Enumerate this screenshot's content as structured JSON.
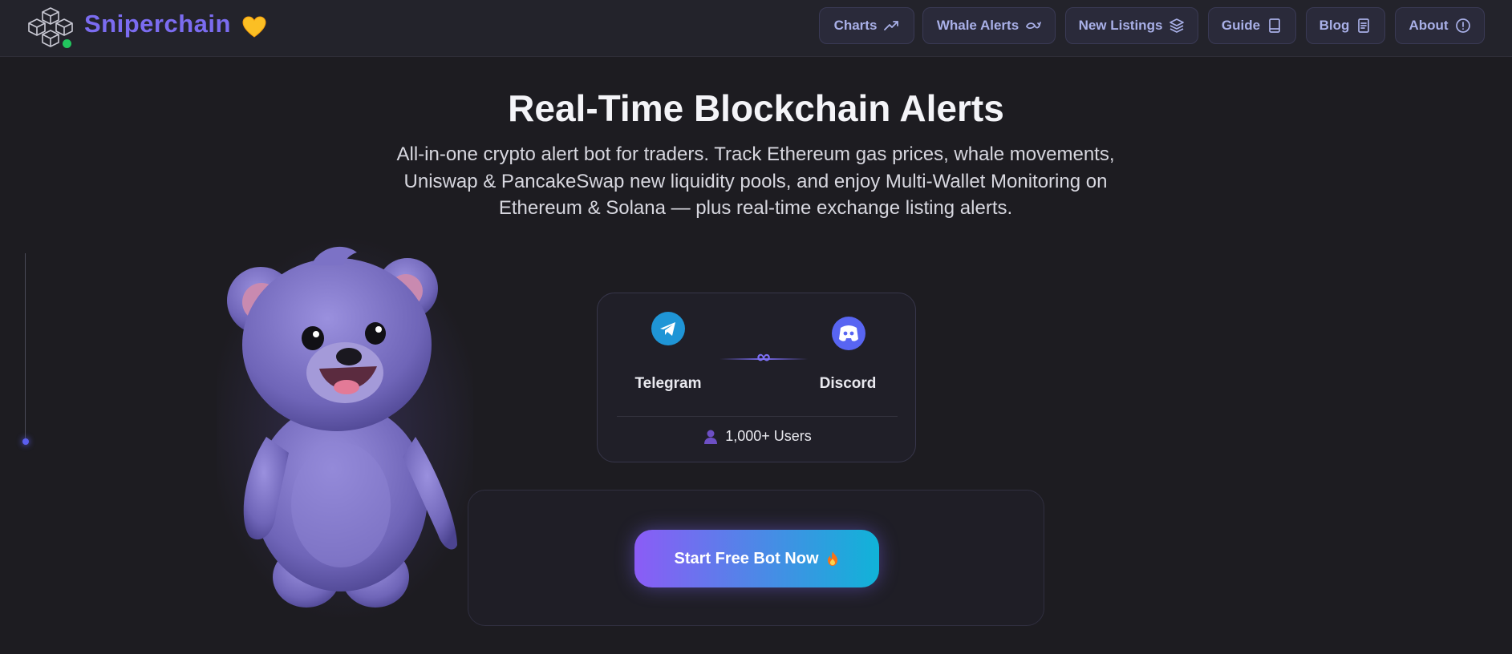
{
  "header": {
    "brand": "Sniperchain",
    "heart_icon": "yellow-heart-icon",
    "status_color": "#22c55e",
    "nav": [
      {
        "label": "Charts",
        "icon": "trending-up-icon"
      },
      {
        "label": "Whale Alerts",
        "icon": "whale-icon"
      },
      {
        "label": "New Listings",
        "icon": "layers-icon"
      },
      {
        "label": "Guide",
        "icon": "book-icon"
      },
      {
        "label": "Blog",
        "icon": "document-icon"
      },
      {
        "label": "About",
        "icon": "info-circle-icon"
      }
    ]
  },
  "hero": {
    "title": "Real-Time Blockchain Alerts",
    "description": "All-in-one crypto alert bot for traders. Track Ethereum gas prices, whale movements, Uniswap & PancakeSwap new liquidity pools, and enjoy Multi-Wallet Monitoring on Ethereum & Solana — plus real-time exchange listing alerts."
  },
  "integrations": {
    "telegram": {
      "label": "Telegram",
      "icon": "telegram-icon",
      "color": "#1f95d6"
    },
    "discord": {
      "label": "Discord",
      "icon": "discord-icon",
      "color": "#5865f2"
    },
    "link_symbol": "∞",
    "users": "1,000+ Users",
    "users_icon": "user-icon"
  },
  "cta": {
    "label": "Start Free Bot Now",
    "icon": "fire-icon"
  },
  "colors": {
    "accent": "#7b6cf0",
    "background": "#1d1c21",
    "gradient_start": "#8b5cf6",
    "gradient_end": "#10b3d8"
  }
}
